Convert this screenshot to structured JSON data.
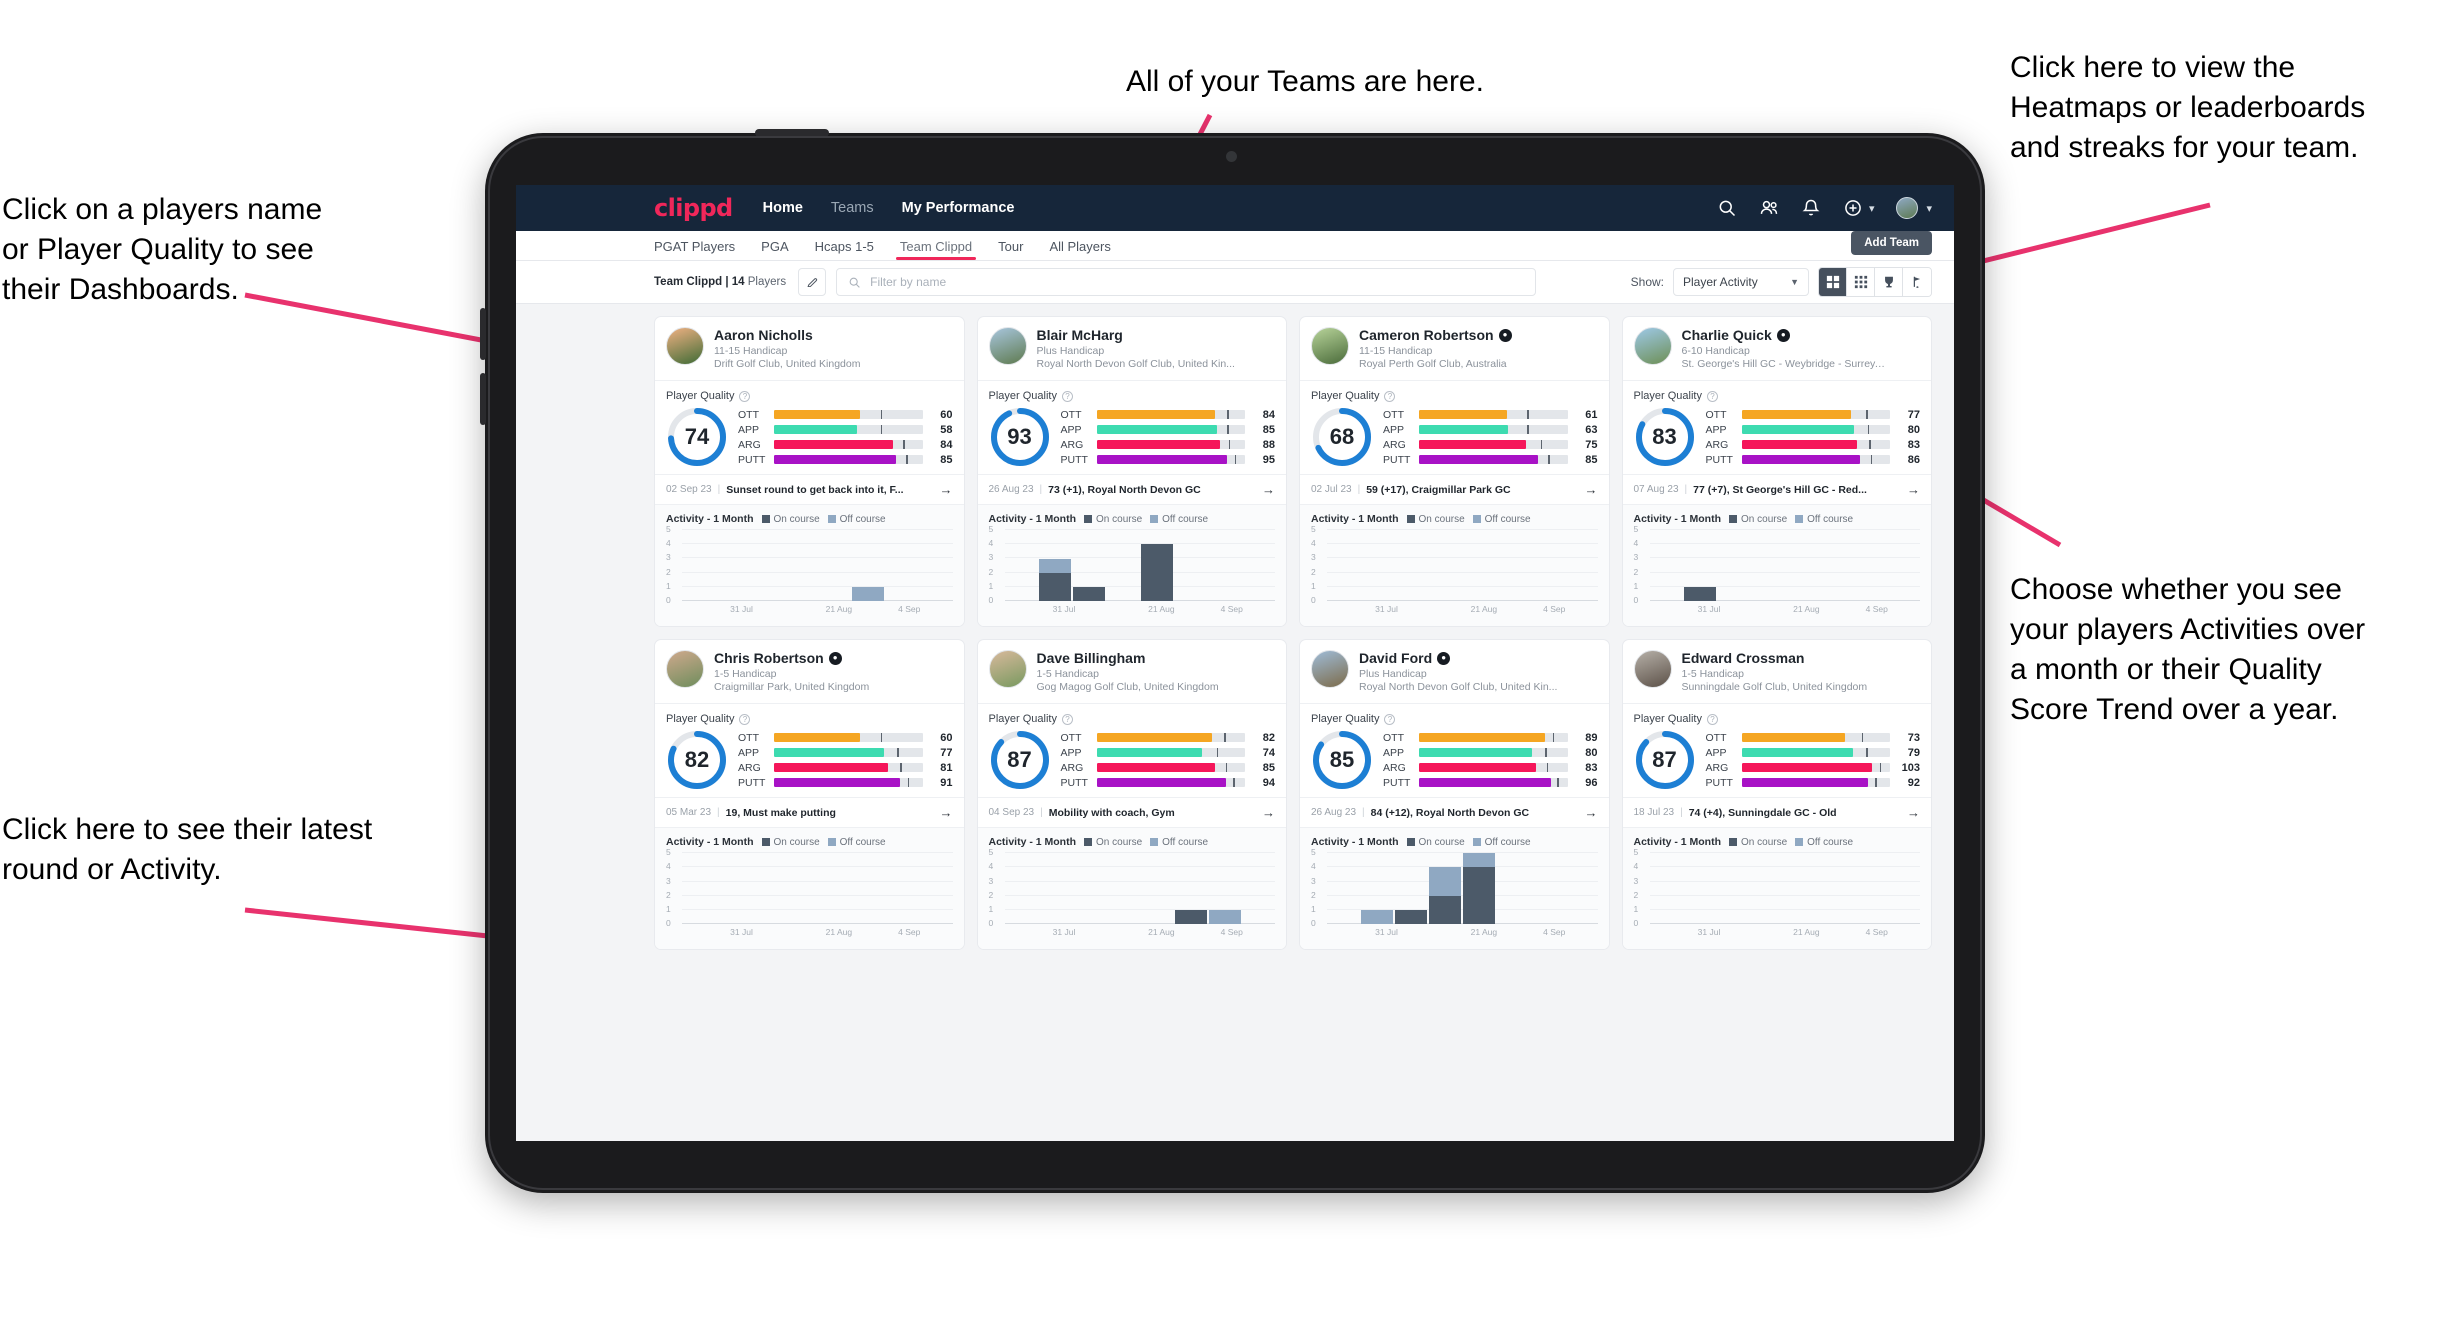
{
  "annotations": [
    {
      "id": "teams",
      "text": "All of your Teams are here."
    },
    {
      "id": "heatmaps",
      "text": "Click here to view the\nHeatmaps or leaderboards\nand streaks for your team."
    },
    {
      "id": "names",
      "text": "Click on a players name\nor Player Quality to see\ntheir Dashboards."
    },
    {
      "id": "activity-choice",
      "text": "Choose whether you see\nyour players Activities over\na month or their Quality\nScore Trend over a year."
    },
    {
      "id": "latest-round",
      "text": "Click here to see their latest\nround or Activity."
    }
  ],
  "app": {
    "logo": "clippd",
    "nav": [
      {
        "label": "Home",
        "active": true
      },
      {
        "label": "Teams",
        "active": false
      },
      {
        "label": "My Performance",
        "active": true
      }
    ],
    "header_icons": [
      "search-icon",
      "people-icon",
      "bell-icon",
      "plus-circle-icon",
      "avatar"
    ],
    "subtabs": [
      {
        "label": "PGAT Players",
        "active": false
      },
      {
        "label": "PGA",
        "active": false
      },
      {
        "label": "Hcaps 1-5",
        "active": false
      },
      {
        "label": "Team Clippd",
        "active": true
      },
      {
        "label": "Tour",
        "active": false
      },
      {
        "label": "All Players",
        "active": false
      }
    ],
    "add_team_label": "Add Team",
    "team_label_prefix": "Team Clippd | ",
    "team_count": "14",
    "team_label_suffix": " Players",
    "search_placeholder": "Filter by name",
    "show_label": "Show:",
    "show_value": "Player Activity",
    "view_modes": [
      "grid-large-icon",
      "grid-small-icon",
      "trophy-icon",
      "golf-flag-icon"
    ],
    "active_view": 0
  },
  "quality_colors": {
    "ott": "#f5a623",
    "app": "#3ddbb0",
    "arg": "#f5165a",
    "putt": "#a812c6",
    "ring": "#1d7fd4",
    "track": "#e3e6ea"
  },
  "activity_colors": {
    "on_course": "#4c5a69",
    "off_course": "#8fa8c2"
  },
  "activity_common": {
    "title": "Activity - 1 Month",
    "legend_on": "On course",
    "legend_off": "Off course",
    "yticks": [
      "5",
      "4",
      "3",
      "2",
      "1",
      "0"
    ],
    "xticks": [
      "31 Jul",
      "21 Aug",
      "4 Sep"
    ],
    "ymax": 5
  },
  "quality_section_label": "Player Quality",
  "players": [
    {
      "name": "Aaron Nicholls",
      "verified": false,
      "handicap": "11-15 Handicap",
      "club": "Drift Golf Club, United Kingdom",
      "score": 74,
      "metrics": [
        {
          "key": "OTT",
          "value": 60,
          "fill": 58,
          "tick": 72
        },
        {
          "key": "APP",
          "value": 58,
          "fill": 56,
          "tick": 72
        },
        {
          "key": "ARG",
          "value": 84,
          "fill": 80,
          "tick": 87
        },
        {
          "key": "PUTT",
          "value": 85,
          "fill": 82,
          "tick": 89
        }
      ],
      "round": {
        "date": "02 Sep 23",
        "title": "Sunset round to get back into it, F..."
      },
      "chart_data": {
        "type": "bar",
        "on_course": [
          0,
          0,
          0,
          0,
          0,
          0,
          0,
          0
        ],
        "off_course": [
          0,
          0,
          0,
          0,
          0,
          1,
          0,
          0
        ]
      }
    },
    {
      "name": "Blair McHarg",
      "verified": false,
      "handicap": "Plus Handicap",
      "club": "Royal North Devon Golf Club, United Kin...",
      "score": 93,
      "metrics": [
        {
          "key": "OTT",
          "value": 84,
          "fill": 80,
          "tick": 88
        },
        {
          "key": "APP",
          "value": 85,
          "fill": 81,
          "tick": 88
        },
        {
          "key": "ARG",
          "value": 88,
          "fill": 83,
          "tick": 89
        },
        {
          "key": "PUTT",
          "value": 95,
          "fill": 88,
          "tick": 93
        }
      ],
      "round": {
        "date": "26 Aug 23",
        "title": "73 (+1), Royal North Devon GC"
      },
      "chart_data": {
        "type": "bar",
        "on_course": [
          0,
          2,
          1,
          0,
          4,
          0,
          0,
          0
        ],
        "off_course": [
          0,
          1,
          0,
          0,
          0,
          0,
          0,
          0
        ]
      }
    },
    {
      "name": "Cameron Robertson",
      "verified": true,
      "handicap": "11-15 Handicap",
      "club": "Royal Perth Golf Club, Australia",
      "score": 68,
      "metrics": [
        {
          "key": "OTT",
          "value": 61,
          "fill": 59,
          "tick": 73
        },
        {
          "key": "APP",
          "value": 63,
          "fill": 60,
          "tick": 73
        },
        {
          "key": "ARG",
          "value": 75,
          "fill": 72,
          "tick": 82
        },
        {
          "key": "PUTT",
          "value": 85,
          "fill": 80,
          "tick": 87
        }
      ],
      "round": {
        "date": "02 Jul 23",
        "title": "59 (+17), Craigmillar Park GC"
      },
      "chart_data": {
        "type": "bar",
        "on_course": [
          0,
          0,
          0,
          0,
          0,
          0,
          0,
          0
        ],
        "off_course": [
          0,
          0,
          0,
          0,
          0,
          0,
          0,
          0
        ]
      }
    },
    {
      "name": "Charlie Quick",
      "verified": true,
      "handicap": "6-10 Handicap",
      "club": "St. George's Hill GC - Weybridge - Surrey, ...",
      "score": 83,
      "metrics": [
        {
          "key": "OTT",
          "value": 77,
          "fill": 74,
          "tick": 84
        },
        {
          "key": "APP",
          "value": 80,
          "fill": 76,
          "tick": 85
        },
        {
          "key": "ARG",
          "value": 83,
          "fill": 78,
          "tick": 86
        },
        {
          "key": "PUTT",
          "value": 86,
          "fill": 80,
          "tick": 87
        }
      ],
      "round": {
        "date": "07 Aug 23",
        "title": "77 (+7), St George's Hill GC - Red..."
      },
      "chart_data": {
        "type": "bar",
        "on_course": [
          0,
          1,
          0,
          0,
          0,
          0,
          0,
          0
        ],
        "off_course": [
          0,
          0,
          0,
          0,
          0,
          0,
          0,
          0
        ]
      }
    },
    {
      "name": "Chris Robertson",
      "verified": true,
      "handicap": "1-5 Handicap",
      "club": "Craigmillar Park, United Kingdom",
      "score": 82,
      "metrics": [
        {
          "key": "OTT",
          "value": 60,
          "fill": 58,
          "tick": 72
        },
        {
          "key": "APP",
          "value": 77,
          "fill": 74,
          "tick": 83
        },
        {
          "key": "ARG",
          "value": 81,
          "fill": 77,
          "tick": 85
        },
        {
          "key": "PUTT",
          "value": 91,
          "fill": 85,
          "tick": 90
        }
      ],
      "round": {
        "date": "05 Mar 23",
        "title": "19, Must make putting"
      },
      "chart_data": {
        "type": "bar",
        "on_course": [
          0,
          0,
          0,
          0,
          0,
          0,
          0,
          0
        ],
        "off_course": [
          0,
          0,
          0,
          0,
          0,
          0,
          0,
          0
        ]
      }
    },
    {
      "name": "Dave Billingham",
      "verified": false,
      "handicap": "1-5 Handicap",
      "club": "Gog Magog Golf Club, United Kingdom",
      "score": 87,
      "metrics": [
        {
          "key": "OTT",
          "value": 82,
          "fill": 78,
          "tick": 86
        },
        {
          "key": "APP",
          "value": 74,
          "fill": 71,
          "tick": 81
        },
        {
          "key": "ARG",
          "value": 85,
          "fill": 80,
          "tick": 87
        },
        {
          "key": "PUTT",
          "value": 94,
          "fill": 87,
          "tick": 92
        }
      ],
      "round": {
        "date": "04 Sep 23",
        "title": "Mobility with coach, Gym"
      },
      "chart_data": {
        "type": "bar",
        "on_course": [
          0,
          0,
          0,
          0,
          0,
          1,
          0,
          0
        ],
        "off_course": [
          0,
          0,
          0,
          0,
          0,
          0,
          1,
          0
        ]
      }
    },
    {
      "name": "David Ford",
      "verified": true,
      "handicap": "Plus Handicap",
      "club": "Royal North Devon Golf Club, United Kin...",
      "score": 85,
      "metrics": [
        {
          "key": "OTT",
          "value": 89,
          "fill": 85,
          "tick": 90
        },
        {
          "key": "APP",
          "value": 80,
          "fill": 76,
          "tick": 85
        },
        {
          "key": "ARG",
          "value": 83,
          "fill": 79,
          "tick": 86
        },
        {
          "key": "PUTT",
          "value": 96,
          "fill": 89,
          "tick": 93
        }
      ],
      "round": {
        "date": "26 Aug 23",
        "title": "84 (+12), Royal North Devon GC"
      },
      "chart_data": {
        "type": "bar",
        "on_course": [
          0,
          0,
          1,
          2,
          4,
          0,
          0,
          0
        ],
        "off_course": [
          0,
          1,
          0,
          2,
          1,
          0,
          0,
          0
        ]
      }
    },
    {
      "name": "Edward Crossman",
      "verified": false,
      "handicap": "1-5 Handicap",
      "club": "Sunningdale Golf Club, United Kingdom",
      "score": 87,
      "metrics": [
        {
          "key": "OTT",
          "value": 73,
          "fill": 70,
          "tick": 81
        },
        {
          "key": "APP",
          "value": 79,
          "fill": 75,
          "tick": 84
        },
        {
          "key": "ARG",
          "value": 103,
          "fill": 88,
          "tick": 93
        },
        {
          "key": "PUTT",
          "value": 92,
          "fill": 85,
          "tick": 90
        }
      ],
      "round": {
        "date": "18 Jul 23",
        "title": "74 (+4), Sunningdale GC - Old"
      },
      "chart_data": {
        "type": "bar",
        "on_course": [
          0,
          0,
          0,
          0,
          0,
          0,
          0,
          0
        ],
        "off_course": [
          0,
          0,
          0,
          0,
          0,
          0,
          0,
          0
        ]
      }
    }
  ]
}
